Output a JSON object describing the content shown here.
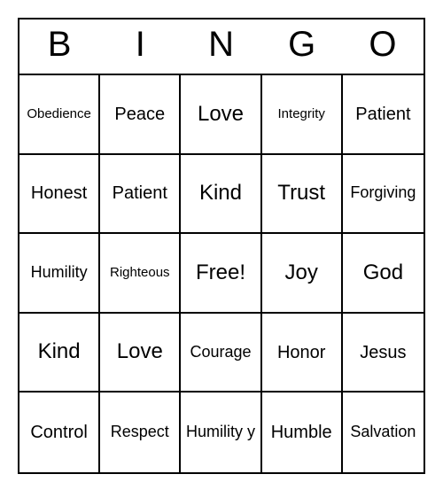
{
  "header": [
    "B",
    "I",
    "N",
    "G",
    "O"
  ],
  "cells": [
    {
      "text": "Obedience",
      "size": "small"
    },
    {
      "text": "Peace",
      "size": ""
    },
    {
      "text": "Love",
      "size": "large"
    },
    {
      "text": "Integrity",
      "size": "small"
    },
    {
      "text": "Patient",
      "size": ""
    },
    {
      "text": "Honest",
      "size": ""
    },
    {
      "text": "Patient",
      "size": ""
    },
    {
      "text": "Kind",
      "size": "large"
    },
    {
      "text": "Trust",
      "size": "large"
    },
    {
      "text": "Forgiving",
      "size": "medium"
    },
    {
      "text": "Humility",
      "size": "medium"
    },
    {
      "text": "Righteous",
      "size": "small"
    },
    {
      "text": "Free!",
      "size": "large"
    },
    {
      "text": "Joy",
      "size": "large"
    },
    {
      "text": "God",
      "size": "large"
    },
    {
      "text": "Kind",
      "size": "large"
    },
    {
      "text": "Love",
      "size": "large"
    },
    {
      "text": "Courage",
      "size": "medium"
    },
    {
      "text": "Honor",
      "size": ""
    },
    {
      "text": "Jesus",
      "size": ""
    },
    {
      "text": "Control",
      "size": ""
    },
    {
      "text": "Respect",
      "size": "medium"
    },
    {
      "text": "Humility y",
      "size": "medium"
    },
    {
      "text": "Humble",
      "size": ""
    },
    {
      "text": "Salvation",
      "size": "medium"
    }
  ]
}
